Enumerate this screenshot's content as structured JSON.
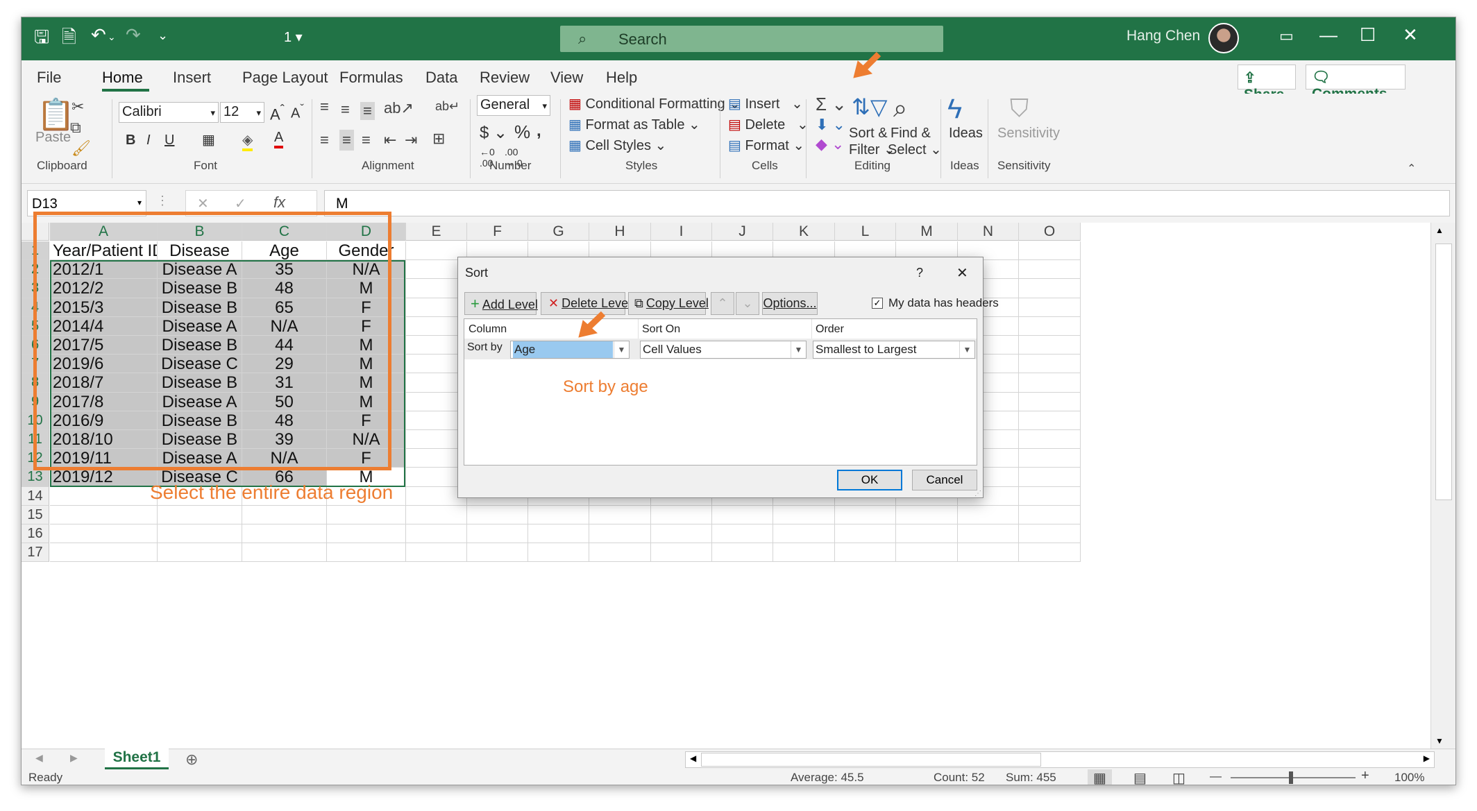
{
  "titlebar": {
    "quick_access_number": "1",
    "search_placeholder": "Search",
    "user_name": "Hang Chen"
  },
  "tabs": [
    "File",
    "Home",
    "Insert",
    "Page Layout",
    "Formulas",
    "Data",
    "Review",
    "View",
    "Help"
  ],
  "top_buttons": {
    "share": "Share",
    "comments": "Comments"
  },
  "ribbon": {
    "clipboard": {
      "paste": "Paste",
      "group": "Clipboard"
    },
    "font": {
      "family": "Calibri",
      "size": "12",
      "group": "Font"
    },
    "alignment": {
      "group": "Alignment"
    },
    "number": {
      "format": "General",
      "group": "Number"
    },
    "styles": {
      "conditional": "Conditional Formatting",
      "format_table": "Format as Table",
      "cell_styles": "Cell Styles",
      "group": "Styles"
    },
    "cells": {
      "insert": "Insert",
      "delete": "Delete",
      "format": "Format",
      "group": "Cells"
    },
    "editing": {
      "sort1": "Sort &",
      "sort2": "Filter",
      "find1": "Find &",
      "find2": "Select",
      "group": "Editing"
    },
    "ideas": {
      "label": "Ideas",
      "group": "Ideas"
    },
    "sensitivity": {
      "label": "Sensitivity",
      "group": "Sensitivity"
    }
  },
  "formula_bar": {
    "name_box": "D13",
    "content": "M"
  },
  "columns": [
    "A",
    "B",
    "C",
    "D",
    "E",
    "F",
    "G",
    "H",
    "I",
    "J",
    "K",
    "L",
    "M",
    "N",
    "O"
  ],
  "headers": [
    "Year/Patient ID",
    "Disease",
    "Age",
    "Gender"
  ],
  "rows": [
    [
      "2012/1",
      "Disease A",
      "35",
      "N/A"
    ],
    [
      "2012/2",
      "Disease B",
      "48",
      "M"
    ],
    [
      "2015/3",
      "Disease B",
      "65",
      "F"
    ],
    [
      "2014/4",
      "Disease A",
      "N/A",
      "F"
    ],
    [
      "2017/5",
      "Disease B",
      "44",
      "M"
    ],
    [
      "2019/6",
      "Disease C",
      "29",
      "M"
    ],
    [
      "2018/7",
      "Disease B",
      "31",
      "M"
    ],
    [
      "2017/8",
      "Disease A",
      "50",
      "M"
    ],
    [
      "2016/9",
      "Disease B",
      "48",
      "F"
    ],
    [
      "2018/10",
      "Disease B",
      "39",
      "N/A"
    ],
    [
      "2019/11",
      "Disease A",
      "N/A",
      "F"
    ],
    [
      "2019/12",
      "Disease C",
      "66",
      "M"
    ]
  ],
  "row_numbers": [
    "1",
    "2",
    "3",
    "4",
    "5",
    "6",
    "7",
    "8",
    "9",
    "10",
    "11",
    "12",
    "13",
    "14",
    "15",
    "16",
    "17"
  ],
  "annotations": {
    "select_region": "Select the entire data region",
    "sort_by_age": "Sort by age"
  },
  "sheet": {
    "tab": "Sheet1"
  },
  "status": {
    "ready": "Ready",
    "average": "Average: 45.5",
    "count": "Count: 52",
    "sum": "Sum: 455",
    "zoom": "100%"
  },
  "dialog": {
    "title": "Sort",
    "help": "?",
    "close": "✕",
    "add_level": "Add Level",
    "delete_level": "Delete Level",
    "copy_level": "Copy Level",
    "options": "Options...",
    "headers_checkbox": "My data has headers",
    "col_header": "Column",
    "sorton_header": "Sort On",
    "order_header": "Order",
    "sort_by": "Sort by",
    "column_value": "Age",
    "sorton_value": "Cell Values",
    "order_value": "Smallest to Largest",
    "ok": "OK",
    "cancel": "Cancel"
  },
  "colors": {
    "accent": "#217346",
    "annotation": "#ed7d31",
    "selection": "#c6c6c6"
  }
}
